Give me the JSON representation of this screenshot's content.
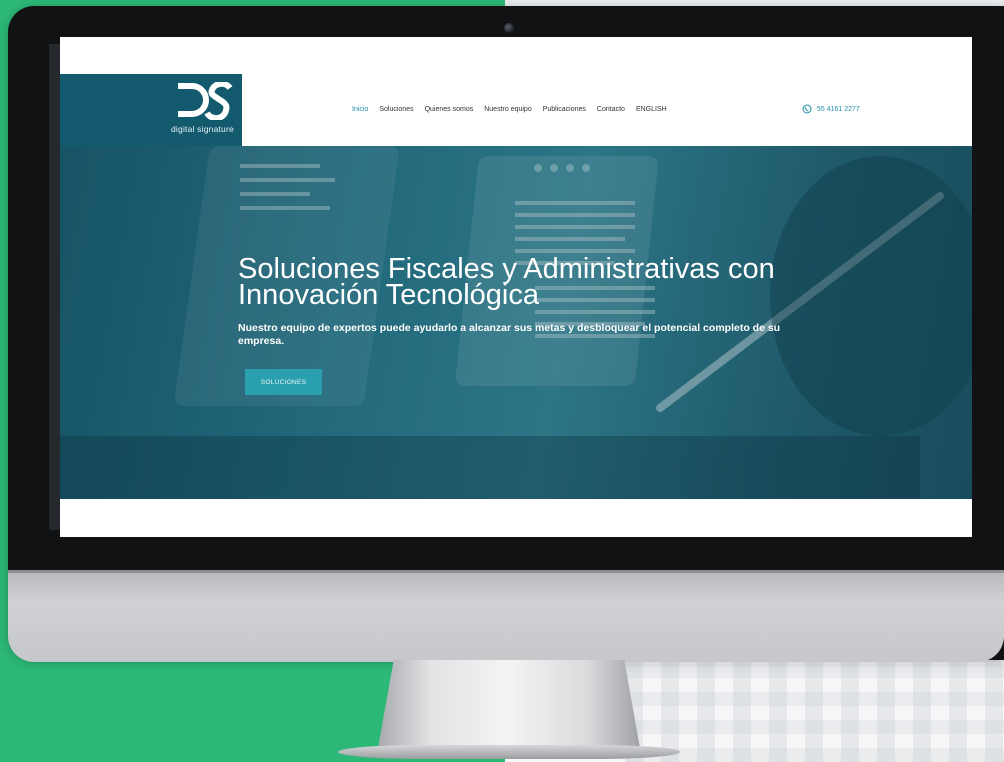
{
  "site": {
    "logo": {
      "mark": "DS",
      "text": "digital signature"
    },
    "nav": [
      {
        "label": "Inicio",
        "active": true
      },
      {
        "label": "Soluciones",
        "active": false
      },
      {
        "label": "Quienes somos",
        "active": false
      },
      {
        "label": "Nuestro equipo",
        "active": false
      },
      {
        "label": "Publicaciones",
        "active": false
      },
      {
        "label": "Contacto",
        "active": false
      },
      {
        "label": "ENGLISH",
        "active": false
      }
    ],
    "phone": {
      "icon": "whatsapp-icon",
      "number": "55 4161 2277"
    },
    "hero": {
      "title_line1": "Soluciones Fiscales y Administrativas con",
      "title_line2": "Innovación Tecnológica",
      "subtitle": "Nuestro equipo de expertos puede ayudarlo a alcanzar sus metas y desbloquear el potencial completo de su empresa.",
      "cta_label": "SOLUCIONES"
    }
  },
  "colors": {
    "brand_teal": "#145a6e",
    "accent": "#1f8fa8",
    "button": "#2a9fad",
    "background_green": "#2cb877"
  }
}
